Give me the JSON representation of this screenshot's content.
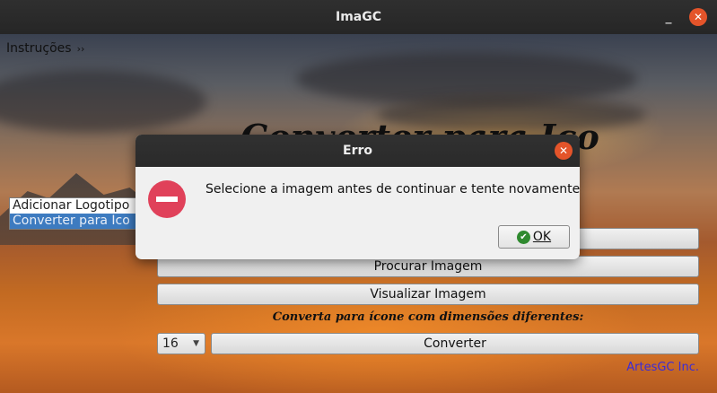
{
  "window": {
    "title": "ImaGC",
    "minimize_glyph": "_",
    "close_glyph": "✕",
    "close_color": "#e4542a"
  },
  "menu": {
    "label": "Instruções",
    "arrow_glyph": "››"
  },
  "main": {
    "title": "Converter para Ico",
    "side_list": [
      {
        "label": "Adicionar Logotipo",
        "selected": false
      },
      {
        "label": "Converter para Ico",
        "selected": true
      }
    ],
    "buttons": {
      "hidden_top": "",
      "browse": "Procurar Imagem",
      "view": "Visualizar Imagem",
      "convert": "Converter"
    },
    "subtitle": "Converta para ícone com dimensões diferentes:",
    "size_select": {
      "value": "16",
      "caret_glyph": "▼"
    },
    "brand": "ArtesGC Inc."
  },
  "dialog": {
    "title": "Erro",
    "close_glyph": "✕",
    "icon": "error-icon",
    "message": "Selecione a imagem antes de continuar e tente novamente..",
    "ok_label": "OK",
    "ok_icon_glyph": "✔"
  }
}
